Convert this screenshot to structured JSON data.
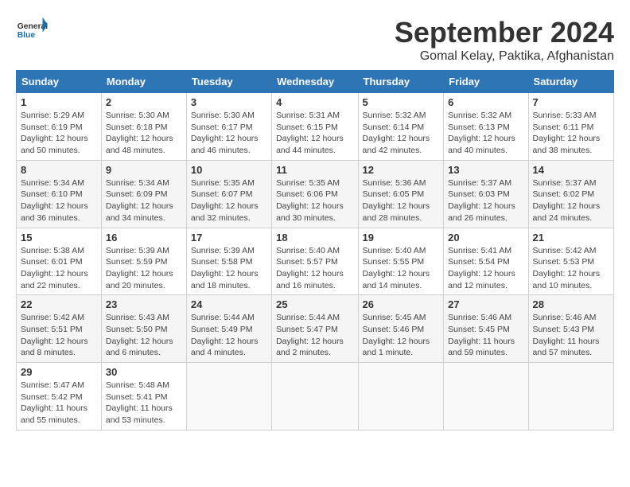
{
  "header": {
    "logo_general": "General",
    "logo_blue": "Blue",
    "month_title": "September 2024",
    "location": "Gomal Kelay, Paktika, Afghanistan"
  },
  "days_of_week": [
    "Sunday",
    "Monday",
    "Tuesday",
    "Wednesday",
    "Thursday",
    "Friday",
    "Saturday"
  ],
  "weeks": [
    [
      {
        "day": "1",
        "sunrise": "Sunrise: 5:29 AM",
        "sunset": "Sunset: 6:19 PM",
        "daylight": "Daylight: 12 hours and 50 minutes."
      },
      {
        "day": "2",
        "sunrise": "Sunrise: 5:30 AM",
        "sunset": "Sunset: 6:18 PM",
        "daylight": "Daylight: 12 hours and 48 minutes."
      },
      {
        "day": "3",
        "sunrise": "Sunrise: 5:30 AM",
        "sunset": "Sunset: 6:17 PM",
        "daylight": "Daylight: 12 hours and 46 minutes."
      },
      {
        "day": "4",
        "sunrise": "Sunrise: 5:31 AM",
        "sunset": "Sunset: 6:15 PM",
        "daylight": "Daylight: 12 hours and 44 minutes."
      },
      {
        "day": "5",
        "sunrise": "Sunrise: 5:32 AM",
        "sunset": "Sunset: 6:14 PM",
        "daylight": "Daylight: 12 hours and 42 minutes."
      },
      {
        "day": "6",
        "sunrise": "Sunrise: 5:32 AM",
        "sunset": "Sunset: 6:13 PM",
        "daylight": "Daylight: 12 hours and 40 minutes."
      },
      {
        "day": "7",
        "sunrise": "Sunrise: 5:33 AM",
        "sunset": "Sunset: 6:11 PM",
        "daylight": "Daylight: 12 hours and 38 minutes."
      }
    ],
    [
      {
        "day": "8",
        "sunrise": "Sunrise: 5:34 AM",
        "sunset": "Sunset: 6:10 PM",
        "daylight": "Daylight: 12 hours and 36 minutes."
      },
      {
        "day": "9",
        "sunrise": "Sunrise: 5:34 AM",
        "sunset": "Sunset: 6:09 PM",
        "daylight": "Daylight: 12 hours and 34 minutes."
      },
      {
        "day": "10",
        "sunrise": "Sunrise: 5:35 AM",
        "sunset": "Sunset: 6:07 PM",
        "daylight": "Daylight: 12 hours and 32 minutes."
      },
      {
        "day": "11",
        "sunrise": "Sunrise: 5:35 AM",
        "sunset": "Sunset: 6:06 PM",
        "daylight": "Daylight: 12 hours and 30 minutes."
      },
      {
        "day": "12",
        "sunrise": "Sunrise: 5:36 AM",
        "sunset": "Sunset: 6:05 PM",
        "daylight": "Daylight: 12 hours and 28 minutes."
      },
      {
        "day": "13",
        "sunrise": "Sunrise: 5:37 AM",
        "sunset": "Sunset: 6:03 PM",
        "daylight": "Daylight: 12 hours and 26 minutes."
      },
      {
        "day": "14",
        "sunrise": "Sunrise: 5:37 AM",
        "sunset": "Sunset: 6:02 PM",
        "daylight": "Daylight: 12 hours and 24 minutes."
      }
    ],
    [
      {
        "day": "15",
        "sunrise": "Sunrise: 5:38 AM",
        "sunset": "Sunset: 6:01 PM",
        "daylight": "Daylight: 12 hours and 22 minutes."
      },
      {
        "day": "16",
        "sunrise": "Sunrise: 5:39 AM",
        "sunset": "Sunset: 5:59 PM",
        "daylight": "Daylight: 12 hours and 20 minutes."
      },
      {
        "day": "17",
        "sunrise": "Sunrise: 5:39 AM",
        "sunset": "Sunset: 5:58 PM",
        "daylight": "Daylight: 12 hours and 18 minutes."
      },
      {
        "day": "18",
        "sunrise": "Sunrise: 5:40 AM",
        "sunset": "Sunset: 5:57 PM",
        "daylight": "Daylight: 12 hours and 16 minutes."
      },
      {
        "day": "19",
        "sunrise": "Sunrise: 5:40 AM",
        "sunset": "Sunset: 5:55 PM",
        "daylight": "Daylight: 12 hours and 14 minutes."
      },
      {
        "day": "20",
        "sunrise": "Sunrise: 5:41 AM",
        "sunset": "Sunset: 5:54 PM",
        "daylight": "Daylight: 12 hours and 12 minutes."
      },
      {
        "day": "21",
        "sunrise": "Sunrise: 5:42 AM",
        "sunset": "Sunset: 5:53 PM",
        "daylight": "Daylight: 12 hours and 10 minutes."
      }
    ],
    [
      {
        "day": "22",
        "sunrise": "Sunrise: 5:42 AM",
        "sunset": "Sunset: 5:51 PM",
        "daylight": "Daylight: 12 hours and 8 minutes."
      },
      {
        "day": "23",
        "sunrise": "Sunrise: 5:43 AM",
        "sunset": "Sunset: 5:50 PM",
        "daylight": "Daylight: 12 hours and 6 minutes."
      },
      {
        "day": "24",
        "sunrise": "Sunrise: 5:44 AM",
        "sunset": "Sunset: 5:49 PM",
        "daylight": "Daylight: 12 hours and 4 minutes."
      },
      {
        "day": "25",
        "sunrise": "Sunrise: 5:44 AM",
        "sunset": "Sunset: 5:47 PM",
        "daylight": "Daylight: 12 hours and 2 minutes."
      },
      {
        "day": "26",
        "sunrise": "Sunrise: 5:45 AM",
        "sunset": "Sunset: 5:46 PM",
        "daylight": "Daylight: 12 hours and 1 minute."
      },
      {
        "day": "27",
        "sunrise": "Sunrise: 5:46 AM",
        "sunset": "Sunset: 5:45 PM",
        "daylight": "Daylight: 11 hours and 59 minutes."
      },
      {
        "day": "28",
        "sunrise": "Sunrise: 5:46 AM",
        "sunset": "Sunset: 5:43 PM",
        "daylight": "Daylight: 11 hours and 57 minutes."
      }
    ],
    [
      {
        "day": "29",
        "sunrise": "Sunrise: 5:47 AM",
        "sunset": "Sunset: 5:42 PM",
        "daylight": "Daylight: 11 hours and 55 minutes."
      },
      {
        "day": "30",
        "sunrise": "Sunrise: 5:48 AM",
        "sunset": "Sunset: 5:41 PM",
        "daylight": "Daylight: 11 hours and 53 minutes."
      },
      null,
      null,
      null,
      null,
      null
    ]
  ]
}
